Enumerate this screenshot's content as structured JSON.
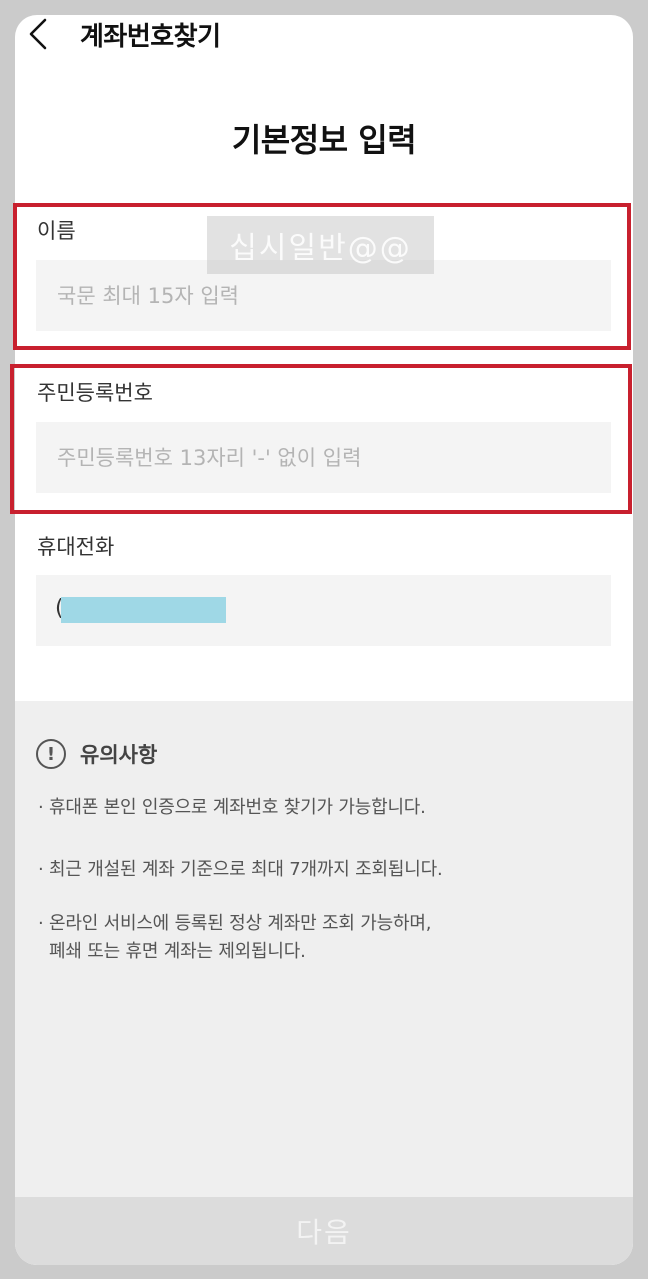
{
  "header": {
    "title": "계좌번호찾기",
    "back_icon": "chevron-left-icon"
  },
  "page_title": "기본정보 입력",
  "watermark": "십시일반@@",
  "form": {
    "name": {
      "label": "이름",
      "placeholder": "국문 최대 15자 입력",
      "value": ""
    },
    "ssn": {
      "label": "주민등록번호",
      "placeholder": "주민등록번호 13자리 '-' 없이 입력",
      "value": ""
    },
    "phone": {
      "label": "휴대전화",
      "prefix": "("
    }
  },
  "notice": {
    "icon": "exclamation-circle-icon",
    "title": "유의사항",
    "bullet": "·",
    "items": [
      {
        "lines": [
          "휴대폰 본인 인증으로 계좌번호 찾기가 가능합니다."
        ]
      },
      {
        "lines": [
          "최근 개설된 계좌 기준으로 최대 7개까지 조회됩니다."
        ]
      },
      {
        "lines": [
          "온라인 서비스에 등록된 정상 계좌만 조회 가능하며,",
          "폐쇄 또는 휴면 계좌는 제외됩니다."
        ]
      }
    ]
  },
  "next_button": {
    "label": "다음"
  },
  "colors": {
    "highlight": "#c8202e",
    "mask": "#9fd8e6"
  }
}
